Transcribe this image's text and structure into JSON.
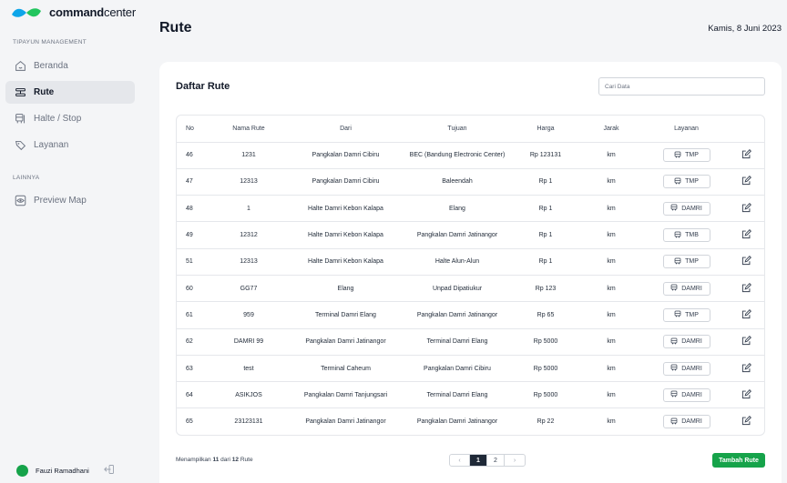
{
  "app": {
    "name_bold": "command",
    "name_rest": "center"
  },
  "sidebar": {
    "section1": "TIPAYUN MANAGEMENT",
    "section2": "LAINNYA",
    "items": [
      {
        "label": "Beranda",
        "icon": "home-icon"
      },
      {
        "label": "Rute",
        "icon": "route-icon"
      },
      {
        "label": "Halte / Stop",
        "icon": "bus-stop-icon"
      },
      {
        "label": "Layanan",
        "icon": "service-icon"
      },
      {
        "label": "Preview Map",
        "icon": "eye-icon"
      }
    ],
    "user": {
      "name": "Fauzi Ramadhani"
    }
  },
  "header": {
    "title": "Rute",
    "date": "Kamis, 8 Juni 2023"
  },
  "card": {
    "title": "Daftar Rute",
    "search_placeholder": "Cari Data",
    "columns": [
      "No",
      "Nama Rute",
      "Dari",
      "Tujuan",
      "Harga",
      "Jarak",
      "Layanan"
    ],
    "rows": [
      {
        "no": "46",
        "nama": "1231",
        "dari": "Pangkalan Damri Cibiru",
        "tujuan": "BEC (Bandung Electronic Center)",
        "harga": "Rp 123131",
        "jarak": "km",
        "layanan": "TMP"
      },
      {
        "no": "47",
        "nama": "12313",
        "dari": "Pangkalan Damri Cibiru",
        "tujuan": "Baleendah",
        "harga": "Rp 1",
        "jarak": "km",
        "layanan": "TMP"
      },
      {
        "no": "48",
        "nama": "1",
        "dari": "Halte Damri Kebon Kalapa",
        "tujuan": "Elang",
        "harga": "Rp 1",
        "jarak": "km",
        "layanan": "DAMRI"
      },
      {
        "no": "49",
        "nama": "12312",
        "dari": "Halte Damri Kebon Kalapa",
        "tujuan": "Pangkalan Damri Jatinangor",
        "harga": "Rp 1",
        "jarak": "km",
        "layanan": "TMB"
      },
      {
        "no": "51",
        "nama": "12313",
        "dari": "Halte Damri Kebon Kalapa",
        "tujuan": "Halte Alun-Alun",
        "harga": "Rp 1",
        "jarak": "km",
        "layanan": "TMP"
      },
      {
        "no": "60",
        "nama": "GG77",
        "dari": "Elang",
        "tujuan": "Unpad Dipatiukur",
        "harga": "Rp 123",
        "jarak": "km",
        "layanan": "DAMRI"
      },
      {
        "no": "61",
        "nama": "959",
        "dari": "Terminal Damri Elang",
        "tujuan": "Pangkalan Damri Jatinangor",
        "harga": "Rp 65",
        "jarak": "km",
        "layanan": "TMP"
      },
      {
        "no": "62",
        "nama": "DAMRI 99",
        "dari": "Pangkalan Damri Jatinangor",
        "tujuan": "Terminal Damri Elang",
        "harga": "Rp 5000",
        "jarak": "km",
        "layanan": "DAMRI"
      },
      {
        "no": "63",
        "nama": "test",
        "dari": "Terminal Caheum",
        "tujuan": "Pangkalan Damri Cibiru",
        "harga": "Rp 5000",
        "jarak": "km",
        "layanan": "DAMRI"
      },
      {
        "no": "64",
        "nama": "ASIKJOS",
        "dari": "Pangkalan Damri Tanjungsari",
        "tujuan": "Terminal Damri Elang",
        "harga": "Rp 5000",
        "jarak": "km",
        "layanan": "DAMRI"
      },
      {
        "no": "65",
        "nama": "23123131",
        "dari": "Pangkalan Damri Jatinangor",
        "tujuan": "Pangkalan Damri Jatinangor",
        "harga": "Rp 22",
        "jarak": "km",
        "layanan": "DAMRI"
      }
    ],
    "footer": {
      "prefix": "Menampilkan ",
      "shown": "11",
      "middle": " dari ",
      "total": "12",
      "suffix": " Rute"
    },
    "pagination": {
      "prev": "‹",
      "pages": [
        "1",
        "2"
      ],
      "current": "1",
      "next": "›"
    },
    "add_button": "Tambah Rute"
  },
  "colors": {
    "accent": "#16a34a",
    "logo_blue": "#0ea5e9",
    "logo_green": "#22c55e",
    "page_active": "#1f2937"
  }
}
